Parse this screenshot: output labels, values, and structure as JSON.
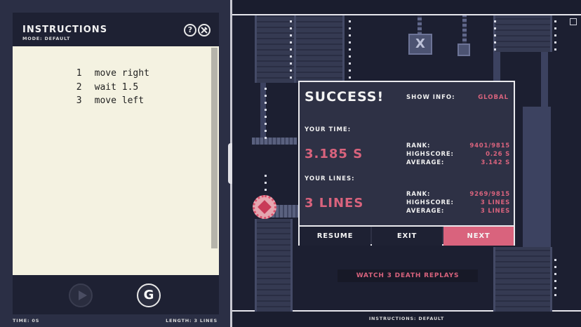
{
  "instructions": {
    "title": "INSTRUCTIONS",
    "mode": "MODE: DEFAULT",
    "help_icon": "?",
    "settings_icon": "wrench-icon",
    "code": [
      {
        "num": "1",
        "text": "move right"
      },
      {
        "num": "2",
        "text": "wait 1.5"
      },
      {
        "num": "3",
        "text": "move left"
      }
    ],
    "run_button_icon": "G",
    "footer_time": "TIME: 0S",
    "footer_length": "LENGTH: 3 LINES"
  },
  "game": {
    "crate_label": "X",
    "footer": "INSTRUCTIONS: DEFAULT",
    "replays": "WATCH 3 DEATH REPLAYS"
  },
  "dialog": {
    "title": "SUCCESS!",
    "show_info_label": "SHOW INFO:",
    "show_info_value": "GLOBAL",
    "your_time_label": "YOUR TIME:",
    "your_time": "3.185 S",
    "time_stats": [
      {
        "label": "RANK:",
        "value": "9401/9815"
      },
      {
        "label": "HIGHSCORE:",
        "value": "0.26 S"
      },
      {
        "label": "AVERAGE:",
        "value": "3.142 S"
      }
    ],
    "your_lines_label": "YOUR LINES:",
    "your_lines": "3 LINES",
    "line_stats": [
      {
        "label": "RANK:",
        "value": "9269/9815"
      },
      {
        "label": "HIGHSCORE:",
        "value": "3 LINES"
      },
      {
        "label": "AVERAGE:",
        "value": "3 LINES"
      }
    ],
    "buttons": {
      "resume": "RESUME",
      "exit": "EXIT",
      "next": "NEXT"
    }
  },
  "colors": {
    "accent": "#d9637d",
    "panel": "#1e2133",
    "editor_bg": "#f4f2e1"
  }
}
